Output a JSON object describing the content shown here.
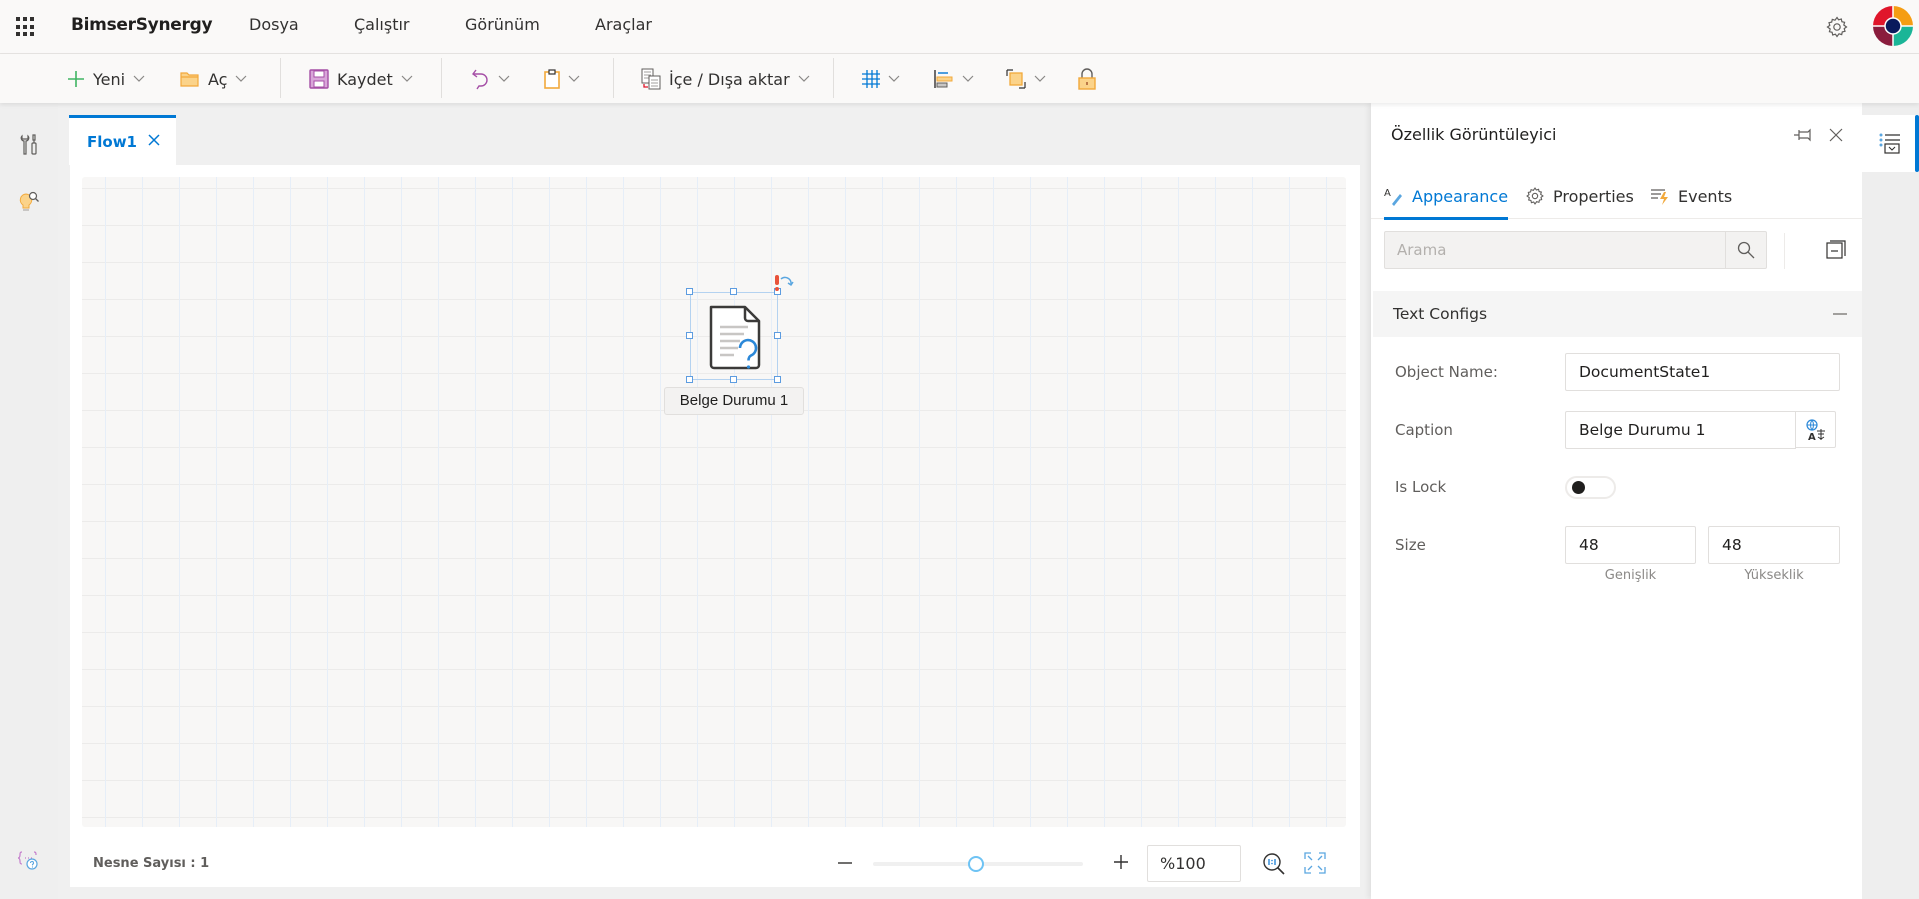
{
  "header": {
    "app_name": "BimserSynergy",
    "menus": [
      "Dosya",
      "Çalıştır",
      "Görünüm",
      "Araçlar"
    ],
    "icons": {
      "app_launcher": "waffle-icon",
      "settings": "gear-icon",
      "logo": "bimser-logo"
    }
  },
  "toolbar": {
    "new_label": "Yeni",
    "open_label": "Aç",
    "save_label": "Kaydet",
    "undo_icon": "undo-icon",
    "paste_icon": "clipboard-icon",
    "import_export_label": "İçe / Dışa aktar",
    "grid_icon": "grid-icon",
    "align_icon": "align-left-icon",
    "arrange_icon": "bring-front-icon",
    "lock_icon": "lock-icon"
  },
  "left_rail": {
    "items": [
      "tools-icon",
      "idea-search-icon",
      "variables-help-icon"
    ]
  },
  "document": {
    "tab_label": "Flow1",
    "node": {
      "caption": "Belge Durumu 1",
      "icon": "document-question-icon"
    }
  },
  "footer": {
    "object_count": "Nesne Sayısı : 1",
    "zoom_value": "%100",
    "zoom_slider_fraction": 0.49
  },
  "property_panel": {
    "title": "Özellik Görüntüleyici",
    "tabs": [
      {
        "label": "Appearance",
        "icon": "text-style-icon",
        "active": true
      },
      {
        "label": "Properties",
        "icon": "gear-icon",
        "active": false
      },
      {
        "label": "Events",
        "icon": "event-bolt-icon",
        "active": false
      }
    ],
    "search_placeholder": "Arama",
    "section_title": "Text Configs",
    "fields": {
      "object_name_label": "Object Name:",
      "object_name_value": "DocumentState1",
      "caption_label": "Caption",
      "caption_value": "Belge Durumu 1",
      "is_lock_label": "Is Lock",
      "is_lock_value": false,
      "size_label": "Size",
      "width_value": "48",
      "height_value": "48",
      "width_sublabel": "Genişlik",
      "height_sublabel": "Yükseklik"
    }
  },
  "colors": {
    "accent": "#0078d4",
    "header_bg": "#faf9f8",
    "new_icon": "#3fb562",
    "save_icon": "#a54fa6",
    "folder_icon": "#f2a93b"
  }
}
